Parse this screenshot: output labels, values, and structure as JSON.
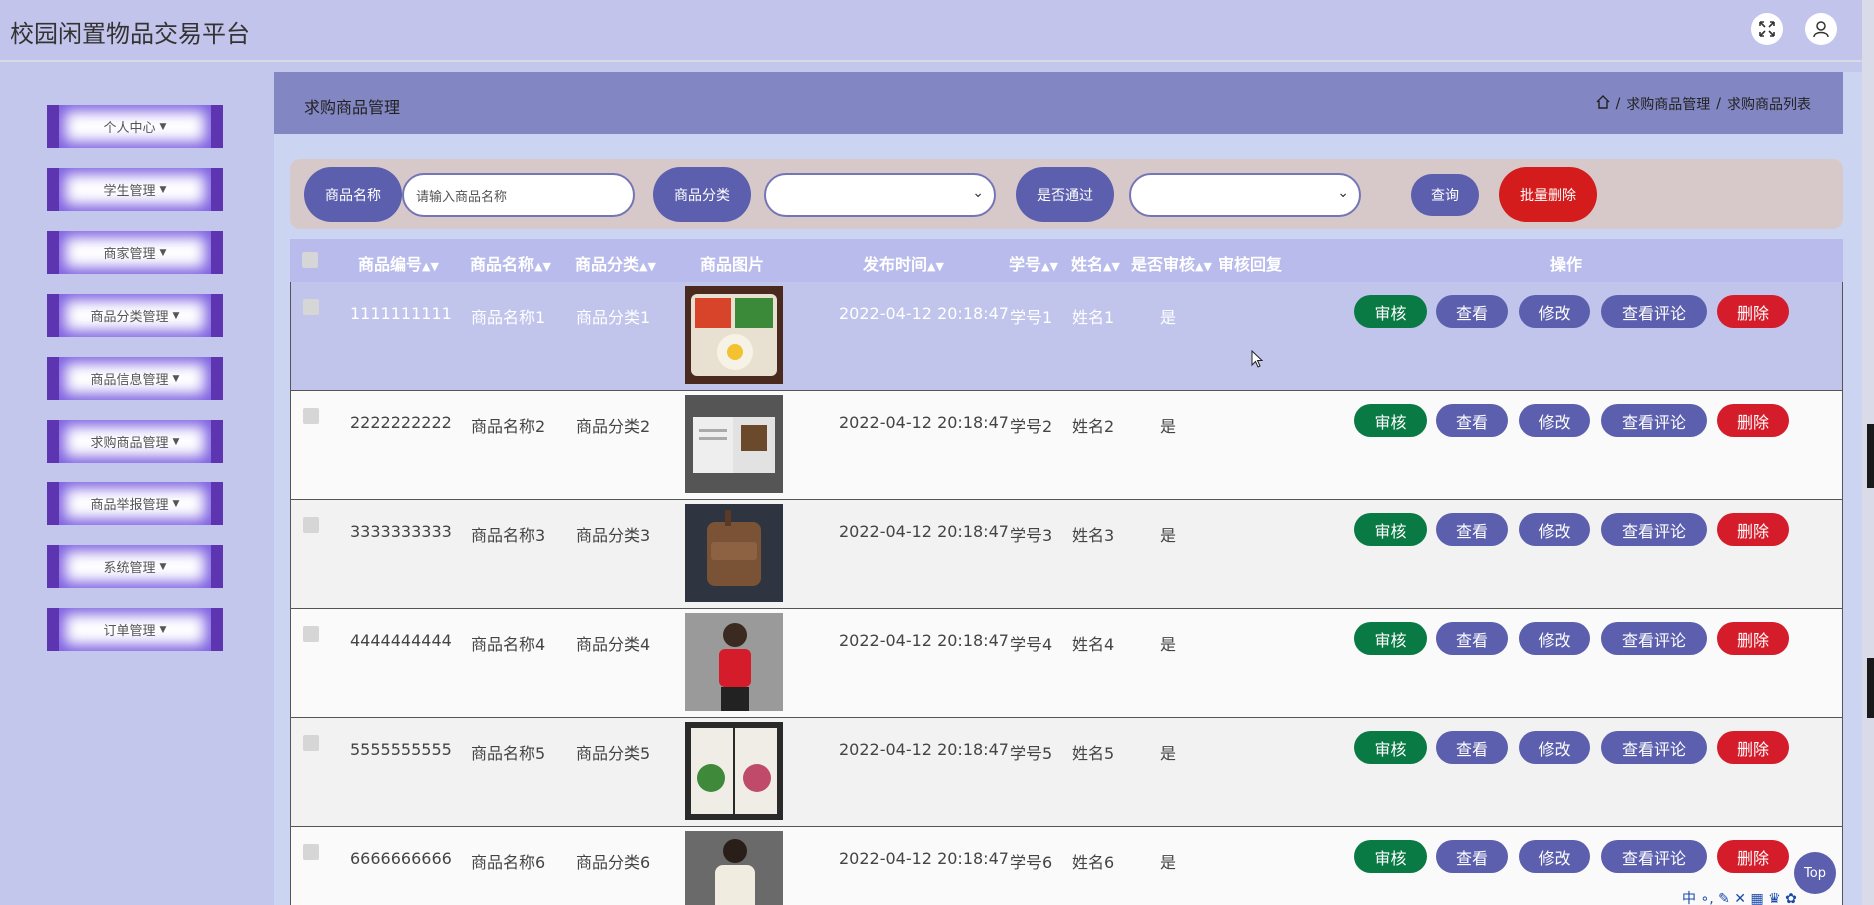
{
  "app": {
    "title": "校园闲置物品交易平台"
  },
  "header": {
    "fullscreen_icon": "expand-icon",
    "user_icon": "user-icon"
  },
  "sidebar": {
    "items": [
      {
        "label": "个人中心"
      },
      {
        "label": "学生管理"
      },
      {
        "label": "商家管理"
      },
      {
        "label": "商品分类管理"
      },
      {
        "label": "商品信息管理"
      },
      {
        "label": "求购商品管理"
      },
      {
        "label": "商品举报管理"
      },
      {
        "label": "系统管理"
      },
      {
        "label": "订单管理"
      }
    ]
  },
  "breadcrumb": {
    "page_title": "求购商品管理",
    "home_icon": "home-icon",
    "sep": "/",
    "level1": "求购商品管理",
    "level2": "求购商品列表"
  },
  "search": {
    "name_label": "商品名称",
    "name_placeholder": "请输入商品名称",
    "category_label": "商品分类",
    "category_value": "",
    "approved_label": "是否通过",
    "approved_value": "",
    "query_button": "查询",
    "batch_delete_button": "批量删除"
  },
  "table": {
    "headers": {
      "code": "商品编号",
      "name": "商品名称",
      "category": "商品分类",
      "image": "商品图片",
      "time": "发布时间",
      "student_no": "学号",
      "student_name": "姓名",
      "audit": "是否审核",
      "reply": "审核回复",
      "actions": "操作"
    },
    "actions": {
      "audit": "审核",
      "view": "查看",
      "edit": "修改",
      "comments": "查看评论",
      "delete": "删除"
    },
    "rows": [
      {
        "code": "1111111111",
        "name": "商品名称1",
        "category": "商品分类1",
        "time": "2022-04-12 20:18:47",
        "student_no": "学号1",
        "student_name": "姓名1",
        "audit": "是",
        "reply": ""
      },
      {
        "code": "2222222222",
        "name": "商品名称2",
        "category": "商品分类2",
        "time": "2022-04-12 20:18:47",
        "student_no": "学号2",
        "student_name": "姓名2",
        "audit": "是",
        "reply": ""
      },
      {
        "code": "3333333333",
        "name": "商品名称3",
        "category": "商品分类3",
        "time": "2022-04-12 20:18:47",
        "student_no": "学号3",
        "student_name": "姓名3",
        "audit": "是",
        "reply": ""
      },
      {
        "code": "4444444444",
        "name": "商品名称4",
        "category": "商品分类4",
        "time": "2022-04-12 20:18:47",
        "student_no": "学号4",
        "student_name": "姓名4",
        "audit": "是",
        "reply": ""
      },
      {
        "code": "5555555555",
        "name": "商品名称5",
        "category": "商品分类5",
        "time": "2022-04-12 20:18:47",
        "student_no": "学号5",
        "student_name": "姓名5",
        "audit": "是",
        "reply": ""
      },
      {
        "code": "6666666666",
        "name": "商品名称6",
        "category": "商品分类6",
        "time": "2022-04-12 20:18:47",
        "student_no": "学号6",
        "student_name": "姓名6",
        "audit": "是",
        "reply": ""
      }
    ]
  },
  "back_to_top": "Top",
  "ime_toolbar": "中 ∘, ✎ ✕ ▦ ♛ ✿"
}
